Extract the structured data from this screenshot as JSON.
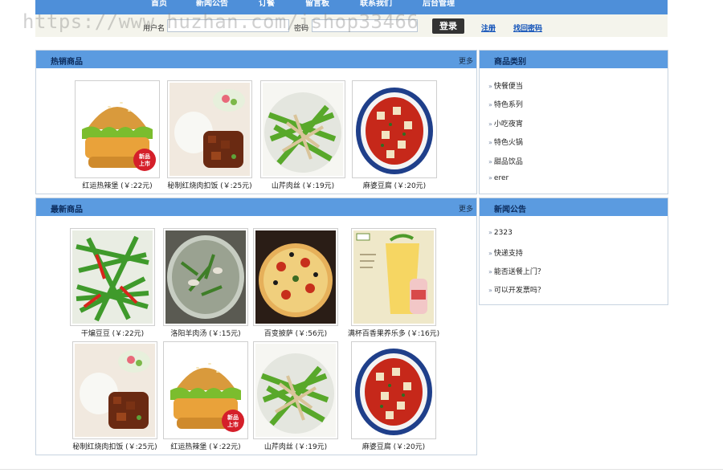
{
  "nav": {
    "items": [
      "首页",
      "新闻公告",
      "订餐",
      "留言板",
      "联系我们",
      "后台管理"
    ]
  },
  "login": {
    "username_label": "用户名",
    "password_label": "密码",
    "username_value": "",
    "password_value": "",
    "login_button": "登录",
    "register_link": "注册",
    "forgot_link": "找回密码"
  },
  "watermark": "https://www.huzhan.com/ishop33466",
  "hot": {
    "title": "热销商品",
    "more": "更多",
    "products": [
      {
        "caption": "红运热辣堡 (￥:22元)",
        "image": "burger-image"
      },
      {
        "caption": "秘制红烧肉扣饭 (￥:25元)",
        "image": "braised-pork-rice-image"
      },
      {
        "caption": "山芹肉丝 (￥:19元)",
        "image": "celery-pork-image"
      },
      {
        "caption": "麻婆豆腐 (￥:20元)",
        "image": "mapo-tofu-image"
      }
    ]
  },
  "newest": {
    "title": "最新商品",
    "more": "更多",
    "products": [
      {
        "caption": "干煸豆豆 (￥:22元)",
        "image": "green-beans-image"
      },
      {
        "caption": "洛阳羊肉汤 (￥:15元)",
        "image": "mutton-soup-image"
      },
      {
        "caption": "百变披萨 (￥:56元)",
        "image": "pizza-image"
      },
      {
        "caption": "满杯百香果养乐多 (￥:16元)",
        "image": "passion-fruit-drink-image"
      },
      {
        "caption": "秘制红烧肉扣饭 (￥:25元)",
        "image": "braised-pork-rice-image"
      },
      {
        "caption": "红运热辣堡 (￥:22元)",
        "image": "burger-image"
      },
      {
        "caption": "山芹肉丝 (￥:19元)",
        "image": "celery-pork-image"
      },
      {
        "caption": "麻婆豆腐 (￥:20元)",
        "image": "mapo-tofu-image"
      }
    ]
  },
  "categories": {
    "title": "商品类别",
    "items": [
      "快餐便当",
      "特色系列",
      "小吃夜宵",
      "特色火锅",
      "甜品饮品",
      "erer"
    ]
  },
  "news": {
    "title": "新闻公告",
    "items": [
      "2323",
      "快递支持",
      "能否送餐上门？",
      "可以开发票吗？"
    ]
  },
  "badge_text": [
    "新品",
    "上市"
  ],
  "colors": {
    "nav_bg": "#4e8fd9",
    "panel_head": "#5b9be0",
    "link": "#0d4fb8"
  }
}
